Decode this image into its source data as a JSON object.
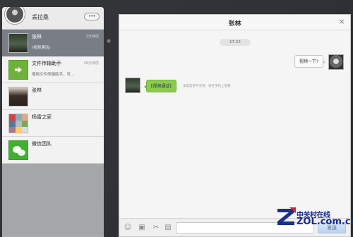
{
  "profile": {
    "name": "丢拉桑",
    "menu_label": "•••"
  },
  "chat_list": [
    {
      "title": "张林",
      "time": "3分钟前",
      "preview": "[视频通话]",
      "thumb": "video-avatar"
    },
    {
      "title": "文件传输助手",
      "time": "48分钟前",
      "preview": "使用文件传输助手，可...",
      "thumb": "file-transfer-icon"
    },
    {
      "title": "张林",
      "time": "",
      "preview": "",
      "thumb": "person-avatar"
    },
    {
      "title": "杨雷之家",
      "time": "",
      "preview": "",
      "thumb": "group-avatar"
    },
    {
      "title": "微信团队",
      "time": "",
      "preview": "",
      "thumb": "wechat-icon"
    }
  ],
  "chat": {
    "title": "张林",
    "close_label": "×",
    "timestamp": "17:23",
    "messages": [
      {
        "direction": "out",
        "text": "视频一下?"
      },
      {
        "direction": "in",
        "text": "[视频通话]"
      }
    ],
    "notice": "该类型暂不支持，请在手机上查看",
    "input_value": "",
    "send_label": "发送"
  },
  "watermark": {
    "brand_cn": "中关村在线",
    "brand_en": "ZOL.com.cn"
  },
  "colors": {
    "accent_green": "#8ccc4a",
    "active_item": "#797e86",
    "brand_blue": "#1a2f8c"
  }
}
